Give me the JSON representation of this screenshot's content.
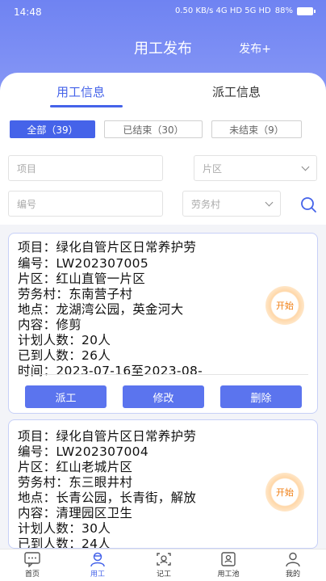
{
  "status": {
    "time": "14:48",
    "network": "0.50 KB/s  4G HD  5G HD",
    "battery": "88%"
  },
  "header": {
    "title": "用工发布",
    "publish": "发布+"
  },
  "tabs": [
    {
      "label": "用工信息",
      "active": true
    },
    {
      "label": "派工信息",
      "active": false
    }
  ],
  "filters": [
    {
      "label": "全部（39）",
      "active": true
    },
    {
      "label": "已结束（30）",
      "active": false
    },
    {
      "label": "未结束（9）",
      "active": false
    }
  ],
  "search": {
    "project": "项目",
    "district": "片区",
    "code": "编号",
    "village": "劳务村"
  },
  "cards": [
    {
      "lines": [
        "项目：绿化自管片区日常养护劳",
        "编号：LW202307005",
        "片区：红山直管一片区",
        "劳务村：东南营子村",
        "地点：龙湖湾公园，英金河大",
        "内容：修剪",
        "计划人数：20人",
        "已到人数：26人",
        "时间：2023-07-16至2023-08-"
      ],
      "badge": "开始",
      "actions": [
        "派工",
        "修改",
        "删除"
      ]
    },
    {
      "lines": [
        "项目：绿化自管片区日常养护劳",
        "编号：LW202307004",
        "片区：红山老城片区",
        "劳务村：东三眼井村",
        "地点：长青公园，长青街，解放",
        "内容：清理园区卫生",
        "计划人数：30人",
        "已到人数：24人"
      ],
      "badge": "开始"
    }
  ],
  "nav": [
    {
      "label": "首页",
      "icon": "chat-icon",
      "active": false
    },
    {
      "label": "用工",
      "icon": "worker-icon",
      "active": true
    },
    {
      "label": "记工",
      "icon": "scan-face-icon",
      "active": false
    },
    {
      "label": "用工池",
      "icon": "id-card-icon",
      "active": false
    },
    {
      "label": "我的",
      "icon": "user-icon",
      "active": false
    }
  ],
  "colors": {
    "primary": "#4563e9",
    "header": "#6f83f2",
    "badge": "#f07e12"
  }
}
